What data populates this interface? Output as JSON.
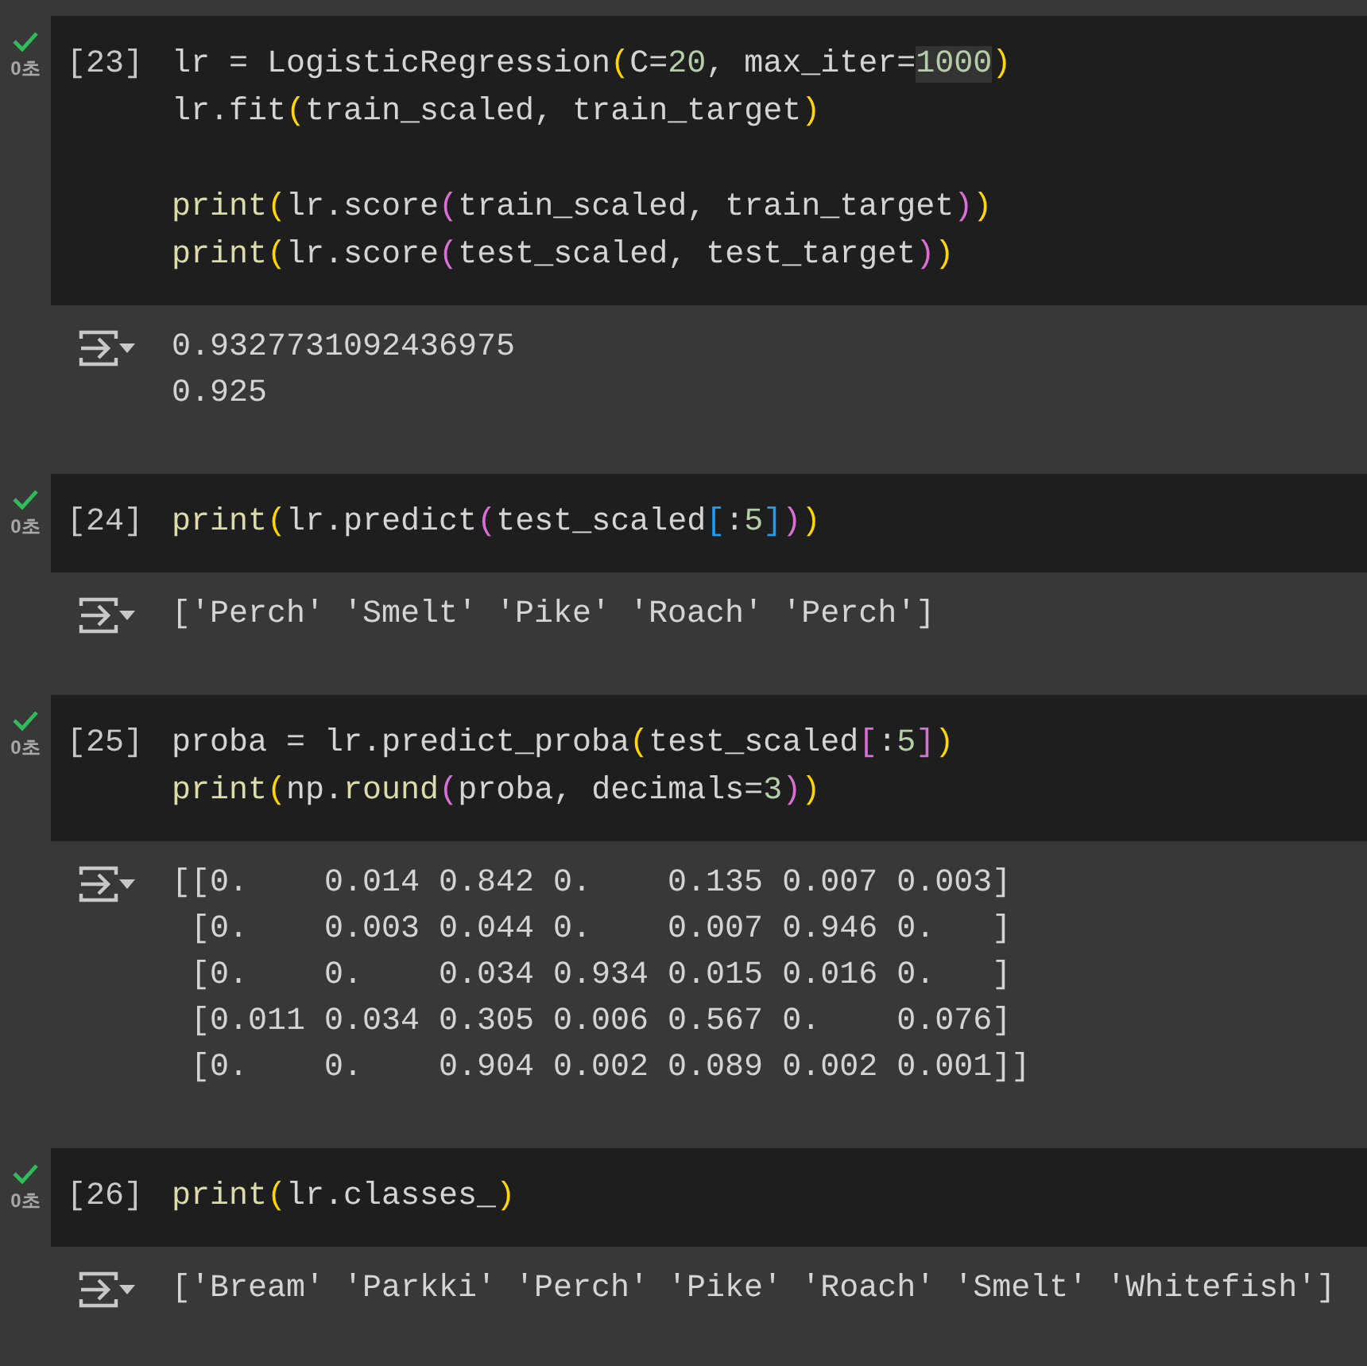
{
  "cells": [
    {
      "succeeded": true,
      "execution_time": "0초",
      "execution_count": "[23]",
      "code_lines": [
        {
          "kind": "code",
          "tokens": [
            {
              "text": "lr = LogisticRegression",
              "kind": "plain"
            },
            {
              "text": "(",
              "kind": "bracket1"
            },
            {
              "text": "C=",
              "kind": "plain"
            },
            {
              "text": "20",
              "kind": "number"
            },
            {
              "text": ", max_iter=",
              "kind": "plain"
            },
            {
              "text": "1000",
              "kind": "number",
              "highlighted": true
            },
            {
              "text": ")",
              "kind": "bracket1"
            }
          ]
        },
        {
          "kind": "code",
          "tokens": [
            {
              "text": "lr.fit",
              "kind": "plain"
            },
            {
              "text": "(",
              "kind": "bracket1"
            },
            {
              "text": "train_scaled, train_target",
              "kind": "plain"
            },
            {
              "text": ")",
              "kind": "bracket1"
            }
          ]
        },
        {
          "kind": "blank"
        },
        {
          "kind": "code",
          "tokens": [
            {
              "text": "print",
              "kind": "function"
            },
            {
              "text": "(",
              "kind": "bracket1"
            },
            {
              "text": "lr.score",
              "kind": "plain"
            },
            {
              "text": "(",
              "kind": "bracket2"
            },
            {
              "text": "train_scaled, train_target",
              "kind": "plain"
            },
            {
              "text": ")",
              "kind": "bracket2"
            },
            {
              "text": ")",
              "kind": "bracket1"
            }
          ]
        },
        {
          "kind": "code",
          "tokens": [
            {
              "text": "print",
              "kind": "function"
            },
            {
              "text": "(",
              "kind": "bracket1"
            },
            {
              "text": "lr.score",
              "kind": "plain"
            },
            {
              "text": "(",
              "kind": "bracket2"
            },
            {
              "text": "test_scaled, test_target",
              "kind": "plain"
            },
            {
              "text": ")",
              "kind": "bracket2"
            },
            {
              "text": ")",
              "kind": "bracket1"
            }
          ]
        }
      ],
      "output_lines": [
        "0.9327731092436975",
        "0.925"
      ]
    },
    {
      "succeeded": true,
      "execution_time": "0초",
      "execution_count": "[24]",
      "code_lines": [
        {
          "kind": "code",
          "tokens": [
            {
              "text": "print",
              "kind": "function"
            },
            {
              "text": "(",
              "kind": "bracket1"
            },
            {
              "text": "lr.predict",
              "kind": "plain"
            },
            {
              "text": "(",
              "kind": "bracket2"
            },
            {
              "text": "test_scaled",
              "kind": "plain"
            },
            {
              "text": "[",
              "kind": "bracket3"
            },
            {
              "text": ":",
              "kind": "plain"
            },
            {
              "text": "5",
              "kind": "number"
            },
            {
              "text": "]",
              "kind": "bracket3"
            },
            {
              "text": ")",
              "kind": "bracket2"
            },
            {
              "text": ")",
              "kind": "bracket1"
            }
          ]
        }
      ],
      "output_lines": [
        "['Perch' 'Smelt' 'Pike' 'Roach' 'Perch']"
      ]
    },
    {
      "succeeded": true,
      "execution_time": "0초",
      "execution_count": "[25]",
      "code_lines": [
        {
          "kind": "code",
          "tokens": [
            {
              "text": "proba = lr.predict_proba",
              "kind": "plain"
            },
            {
              "text": "(",
              "kind": "bracket1"
            },
            {
              "text": "test_scaled",
              "kind": "plain"
            },
            {
              "text": "[",
              "kind": "bracket2"
            },
            {
              "text": ":",
              "kind": "plain"
            },
            {
              "text": "5",
              "kind": "number"
            },
            {
              "text": "]",
              "kind": "bracket2"
            },
            {
              "text": ")",
              "kind": "bracket1"
            }
          ]
        },
        {
          "kind": "code",
          "tokens": [
            {
              "text": "print",
              "kind": "function"
            },
            {
              "text": "(",
              "kind": "bracket1"
            },
            {
              "text": "np.",
              "kind": "plain"
            },
            {
              "text": "round",
              "kind": "function"
            },
            {
              "text": "(",
              "kind": "bracket2"
            },
            {
              "text": "proba, decimals=",
              "kind": "plain"
            },
            {
              "text": "3",
              "kind": "number"
            },
            {
              "text": ")",
              "kind": "bracket2"
            },
            {
              "text": ")",
              "kind": "bracket1"
            }
          ]
        }
      ],
      "output_lines": [
        "[[0.    0.014 0.842 0.    0.135 0.007 0.003]",
        " [0.    0.003 0.044 0.    0.007 0.946 0.   ]",
        " [0.    0.    0.034 0.934 0.015 0.016 0.   ]",
        " [0.011 0.034 0.305 0.006 0.567 0.    0.076]",
        " [0.    0.    0.904 0.002 0.089 0.002 0.001]]"
      ]
    },
    {
      "succeeded": true,
      "execution_time": "0초",
      "execution_count": "[26]",
      "code_lines": [
        {
          "kind": "code",
          "tokens": [
            {
              "text": "print",
              "kind": "function"
            },
            {
              "text": "(",
              "kind": "bracket1"
            },
            {
              "text": "lr.classes_",
              "kind": "plain"
            },
            {
              "text": ")",
              "kind": "bracket1"
            }
          ]
        }
      ],
      "output_lines": [
        "['Bream' 'Parkki' 'Perch' 'Pike' 'Roach' 'Smelt' 'Whitefish']"
      ]
    }
  ]
}
